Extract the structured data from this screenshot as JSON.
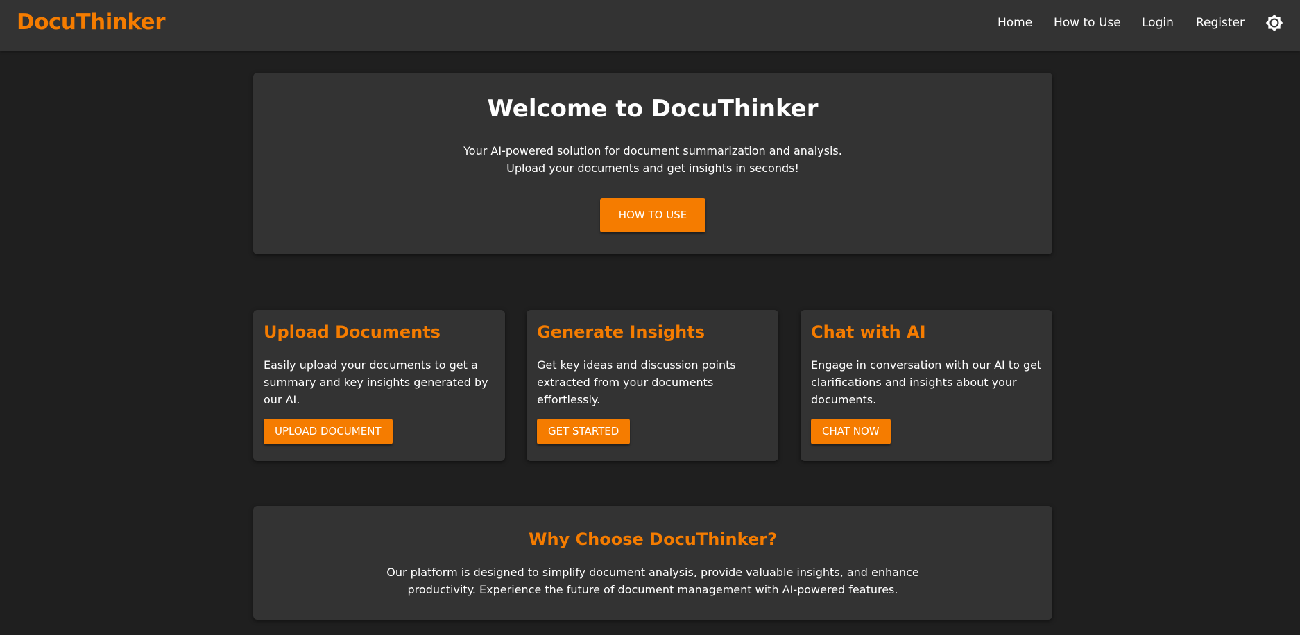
{
  "header": {
    "brand": "DocuThinker",
    "nav": [
      "Home",
      "How to Use",
      "Login",
      "Register"
    ],
    "theme_icon": "gear-icon"
  },
  "hero": {
    "title": "Welcome to DocuThinker",
    "subtitle_lines": [
      "Your AI-powered solution for document summarization and analysis.",
      "Upload your documents and get insights in seconds!"
    ],
    "button": "HOW TO USE"
  },
  "features": [
    {
      "title": "Upload Documents",
      "description": "Easily upload your documents to get a summary and key insights generated by our AI.",
      "button": "UPLOAD DOCUMENT"
    },
    {
      "title": "Generate Insights",
      "description": "Get key ideas and discussion points extracted from your documents effortlessly.",
      "button": "GET STARTED"
    },
    {
      "title": "Chat with AI",
      "description": "Engage in conversation with our AI to get clarifications and insights about your documents.",
      "button": "CHAT NOW"
    }
  ],
  "why": {
    "title": "Why Choose DocuThinker?",
    "description": "Our platform is designed to simplify document analysis, provide valuable insights, and enhance productivity. Experience the future of document management with AI-powered features."
  },
  "colors": {
    "accent": "#f57c00",
    "background": "#1f1f1f",
    "card": "#333333"
  }
}
